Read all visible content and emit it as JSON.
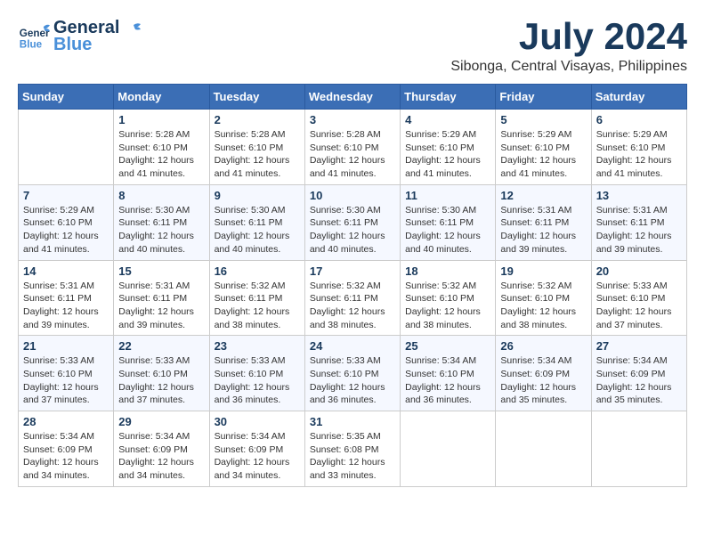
{
  "header": {
    "logo_line1": "General",
    "logo_line2": "Blue",
    "month": "July 2024",
    "location": "Sibonga, Central Visayas, Philippines"
  },
  "weekdays": [
    "Sunday",
    "Monday",
    "Tuesday",
    "Wednesday",
    "Thursday",
    "Friday",
    "Saturday"
  ],
  "weeks": [
    [
      {
        "day": "",
        "info": ""
      },
      {
        "day": "1",
        "info": "Sunrise: 5:28 AM\nSunset: 6:10 PM\nDaylight: 12 hours\nand 41 minutes."
      },
      {
        "day": "2",
        "info": "Sunrise: 5:28 AM\nSunset: 6:10 PM\nDaylight: 12 hours\nand 41 minutes."
      },
      {
        "day": "3",
        "info": "Sunrise: 5:28 AM\nSunset: 6:10 PM\nDaylight: 12 hours\nand 41 minutes."
      },
      {
        "day": "4",
        "info": "Sunrise: 5:29 AM\nSunset: 6:10 PM\nDaylight: 12 hours\nand 41 minutes."
      },
      {
        "day": "5",
        "info": "Sunrise: 5:29 AM\nSunset: 6:10 PM\nDaylight: 12 hours\nand 41 minutes."
      },
      {
        "day": "6",
        "info": "Sunrise: 5:29 AM\nSunset: 6:10 PM\nDaylight: 12 hours\nand 41 minutes."
      }
    ],
    [
      {
        "day": "7",
        "info": "Sunrise: 5:29 AM\nSunset: 6:10 PM\nDaylight: 12 hours\nand 41 minutes."
      },
      {
        "day": "8",
        "info": "Sunrise: 5:30 AM\nSunset: 6:11 PM\nDaylight: 12 hours\nand 40 minutes."
      },
      {
        "day": "9",
        "info": "Sunrise: 5:30 AM\nSunset: 6:11 PM\nDaylight: 12 hours\nand 40 minutes."
      },
      {
        "day": "10",
        "info": "Sunrise: 5:30 AM\nSunset: 6:11 PM\nDaylight: 12 hours\nand 40 minutes."
      },
      {
        "day": "11",
        "info": "Sunrise: 5:30 AM\nSunset: 6:11 PM\nDaylight: 12 hours\nand 40 minutes."
      },
      {
        "day": "12",
        "info": "Sunrise: 5:31 AM\nSunset: 6:11 PM\nDaylight: 12 hours\nand 39 minutes."
      },
      {
        "day": "13",
        "info": "Sunrise: 5:31 AM\nSunset: 6:11 PM\nDaylight: 12 hours\nand 39 minutes."
      }
    ],
    [
      {
        "day": "14",
        "info": "Sunrise: 5:31 AM\nSunset: 6:11 PM\nDaylight: 12 hours\nand 39 minutes."
      },
      {
        "day": "15",
        "info": "Sunrise: 5:31 AM\nSunset: 6:11 PM\nDaylight: 12 hours\nand 39 minutes."
      },
      {
        "day": "16",
        "info": "Sunrise: 5:32 AM\nSunset: 6:11 PM\nDaylight: 12 hours\nand 38 minutes."
      },
      {
        "day": "17",
        "info": "Sunrise: 5:32 AM\nSunset: 6:11 PM\nDaylight: 12 hours\nand 38 minutes."
      },
      {
        "day": "18",
        "info": "Sunrise: 5:32 AM\nSunset: 6:10 PM\nDaylight: 12 hours\nand 38 minutes."
      },
      {
        "day": "19",
        "info": "Sunrise: 5:32 AM\nSunset: 6:10 PM\nDaylight: 12 hours\nand 38 minutes."
      },
      {
        "day": "20",
        "info": "Sunrise: 5:33 AM\nSunset: 6:10 PM\nDaylight: 12 hours\nand 37 minutes."
      }
    ],
    [
      {
        "day": "21",
        "info": "Sunrise: 5:33 AM\nSunset: 6:10 PM\nDaylight: 12 hours\nand 37 minutes."
      },
      {
        "day": "22",
        "info": "Sunrise: 5:33 AM\nSunset: 6:10 PM\nDaylight: 12 hours\nand 37 minutes."
      },
      {
        "day": "23",
        "info": "Sunrise: 5:33 AM\nSunset: 6:10 PM\nDaylight: 12 hours\nand 36 minutes."
      },
      {
        "day": "24",
        "info": "Sunrise: 5:33 AM\nSunset: 6:10 PM\nDaylight: 12 hours\nand 36 minutes."
      },
      {
        "day": "25",
        "info": "Sunrise: 5:34 AM\nSunset: 6:10 PM\nDaylight: 12 hours\nand 36 minutes."
      },
      {
        "day": "26",
        "info": "Sunrise: 5:34 AM\nSunset: 6:09 PM\nDaylight: 12 hours\nand 35 minutes."
      },
      {
        "day": "27",
        "info": "Sunrise: 5:34 AM\nSunset: 6:09 PM\nDaylight: 12 hours\nand 35 minutes."
      }
    ],
    [
      {
        "day": "28",
        "info": "Sunrise: 5:34 AM\nSunset: 6:09 PM\nDaylight: 12 hours\nand 34 minutes."
      },
      {
        "day": "29",
        "info": "Sunrise: 5:34 AM\nSunset: 6:09 PM\nDaylight: 12 hours\nand 34 minutes."
      },
      {
        "day": "30",
        "info": "Sunrise: 5:34 AM\nSunset: 6:09 PM\nDaylight: 12 hours\nand 34 minutes."
      },
      {
        "day": "31",
        "info": "Sunrise: 5:35 AM\nSunset: 6:08 PM\nDaylight: 12 hours\nand 33 minutes."
      },
      {
        "day": "",
        "info": ""
      },
      {
        "day": "",
        "info": ""
      },
      {
        "day": "",
        "info": ""
      }
    ]
  ]
}
